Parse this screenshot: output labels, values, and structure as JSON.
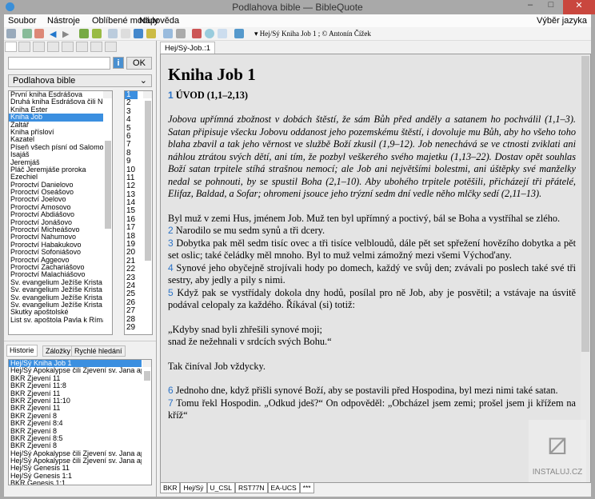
{
  "window": {
    "title": "Podlahova bible — BibleQuote",
    "minimize": "–",
    "maximize": "□",
    "close": "✕"
  },
  "menu": [
    "Soubor",
    "Nástroje",
    "Oblíbené moduly",
    "Nápověda"
  ],
  "menu_right": "Výběr jazyka",
  "toolbar": {
    "reference": "▾ Hej/Sý Kniha Job 1   ; © Antonín Čížek"
  },
  "left": {
    "search_value": "",
    "info_label": "i",
    "ok_label": "OK",
    "module_select": "Podlahova bible",
    "books": [
      "První kniha Esdrášova",
      "Druhá kniha Esdrášova čili Nehemiášova",
      "Kniha Ester",
      "Kniha Job",
      "Žaltář",
      "Kniha přísloví",
      "Kazatel",
      "Píseň všech písní od Šalomouna",
      "Isajáš",
      "Jeremjáš",
      "Pláč Jeremjáše proroka",
      "Ezechiel",
      "Proroctví Danielovo",
      "Proroctví Oseášovo",
      "Proroctví Joelovo",
      "Proroctví Amosovo",
      "Proroctví Abdiášovo",
      "Proroctví Jonášovo",
      "Proroctví Micheášovo",
      "Proroctví Nahumovo",
      "Proroctví Habakukovo",
      "Proroctví Sofoniášovo",
      "Proroctví Aggeovo",
      "Proroctví Zachariášovo",
      "Proroctví Malachiášovo",
      "Sv. evangelium Ježíše Krista podle Matouše",
      "Sv. evangelium Ježíše Krista podle Marka",
      "Sv. evangelium Ježíše Krista podle Lukáše",
      "Sv. evangelium Ježíše Krista podle Jana",
      "Skutky apoštolské",
      "List sv. apoštola Pavla k Římanům"
    ],
    "selected_book": 3,
    "chapters": [
      "1",
      "2",
      "3",
      "4",
      "5",
      "6",
      "7",
      "8",
      "9",
      "10",
      "11",
      "12",
      "13",
      "14",
      "15",
      "16",
      "17",
      "18",
      "19",
      "20",
      "21",
      "22",
      "23",
      "24",
      "25",
      "26",
      "27",
      "28",
      "29"
    ],
    "tabs": [
      "Historie",
      "Záložky",
      "Rychlé hledání"
    ],
    "history": [
      "Hej/Sý Kniha Job 1",
      "Hej/Sý Apokalypse čili Zjevení sv. Jana apoštola",
      "BKR Zjevení 11",
      "BKR Zjevení 11:8",
      "BKR Zjevení 11",
      "BKR Zjevení 11:10",
      "BKR Zjevení 11",
      "BKR Zjevení 8",
      "BKR Zjevení 8:4",
      "BKR Zjevení 8",
      "BKR Zjevení 8:5",
      "BKR Zjevení 8",
      "Hej/Sý Apokalypse čili Zjevení sv. Jana apoštola",
      "Hej/Sý Apokalypse čili Zjevení sv. Jana apoštola",
      "Hej/Sý Genesis 11",
      "Hej/Sý Genesis 1:1",
      "BKR Genesis 1:1"
    ]
  },
  "doc": {
    "tab": "Hej/Sý-Job.:1",
    "title": "Kniha Job 1",
    "heading_num": "1",
    "heading": "ÚVOD (1,1–2,13)",
    "intro": "Jobova upřímná zbožnost v dobách štěstí, že sám Bůh před anděly a satanem ho pochválil (1,1–3). Satan připisuje všecku Jobovu oddanost jeho pozemskému štěstí, i dovoluje mu Bůh, aby ho všeho toho blaha zbavil a tak jeho věrnost ve službě Boží zkusil (1,9–12). Job nenechává se ve ctnosti zviklati ani náhlou ztrátou svých dětí, ani tím, že pozbyl veškerého svého majetku (1,13–22). Dostav opět souhlas Boží satan trpitele stíhá strašnou nemocí; ale Job ani největšími bolestmi, ani úštěpky své manželky nedal se pohnouti, by se spustil Boha (2,1–10). Aby ubohého trpitele potěšili, přicházejí tři přátelé, Elifaz, Baldad, a Sofar; ohromeni jsouce jeho trýzní sedm dní vedle něho mlčky sedí (2,11–13).",
    "v1": "Byl muž v zemi Hus, jménem Job. Muž ten byl upřímný a poctivý, bál se Boha a vystříhal se zlého.",
    "verses": [
      {
        "n": "2",
        "t": "Narodilo se mu sedm synů a tři dcery."
      },
      {
        "n": "3",
        "t": "Dobytka pak měl sedm tisíc ovec a tři tisíce velbloudů, dále pět set spřežení hovězího dobytka a pět set oslic; také čeládky měl mnoho. Byl to muž velmi zámožný mezi všemi Východ'any."
      },
      {
        "n": "4",
        "t": "Synové jeho obyčejně strojívali hody po domech, každý ve svůj den; zvávali po poslech také své tři sestry, aby jedly a pily s nimi."
      },
      {
        "n": "5",
        "t": "Když pak se vystřídaly dokola dny hodů, posílal pro ně Job, aby je posvětil; a vstávaje na úsvitě podával celopaly za každého. Říkával (si) totiž:"
      }
    ],
    "quote1": "„Kdyby snad byli zhřešili synové moji;",
    "quote2": "snad že nežehnali v srdcích svých Bohu.“",
    "after": "Tak činíval Job vždycky.",
    "verses2": [
      {
        "n": "6",
        "t": "Jednoho dne, když přišli synové Boží, aby se postavili před Hospodina, byl mezi nimi také satan."
      },
      {
        "n": "7",
        "t": "Tomu řekl Hospodin. „Odkud jdeš?“ On odpověděl: „Obcházel jsem zemi; prošel jsem ji křížem na kříž“"
      }
    ]
  },
  "bottom_tabs": [
    "BKR",
    "Hej/Sý",
    "U_CSL",
    "RST77N",
    "EA-UCS",
    "***"
  ],
  "watermark": "INSTALUJ.CZ"
}
